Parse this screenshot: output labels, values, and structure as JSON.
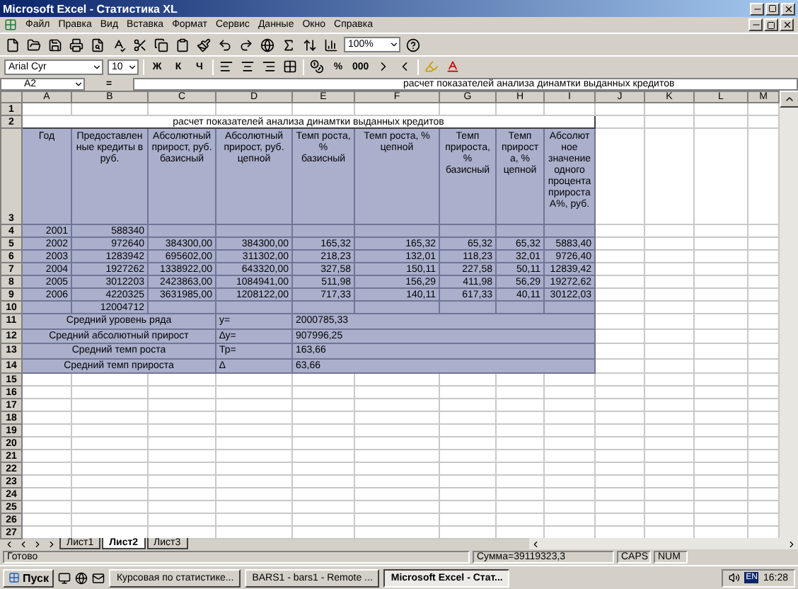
{
  "window": {
    "title": "Microsoft Excel - Статистика XL"
  },
  "menu": [
    "Файл",
    "Правка",
    "Вид",
    "Вставка",
    "Формат",
    "Сервис",
    "Данные",
    "Окно",
    "Справка"
  ],
  "toolbar": {
    "zoom": "100%",
    "font": "Arial Cyr",
    "font_size": "10",
    "format_buttons": [
      "Ж",
      "К",
      "Ч"
    ],
    "number_buttons": [
      "%",
      "000"
    ]
  },
  "formula_bar": {
    "cell": "A2",
    "equals": "=",
    "content": "расчет показателей анализа динамтки выданных кредитов"
  },
  "sheet": {
    "columns": [
      "A",
      "B",
      "C",
      "D",
      "E",
      "F",
      "G",
      "H",
      "I",
      "J",
      "K",
      "L",
      "M"
    ],
    "row_numbers": [
      "1",
      "2",
      "3",
      "4",
      "5",
      "6",
      "7",
      "8",
      "9",
      "10",
      "11",
      "12",
      "13",
      "14",
      "15",
      "16",
      "17",
      "18",
      "19",
      "20",
      "21",
      "22",
      "23",
      "24",
      "25",
      "26",
      "27"
    ],
    "title": "расчет показателей анализа динамтки выданных кредитов",
    "header": [
      "Год",
      "Предоставленные кредиты в руб.",
      "Абсолютный прирост, руб. базисный",
      "Абсолютный прирост, руб. цепной",
      "Темп роста, % базисный",
      "Темп роста, % цепной",
      "Темп прироста, % базисный",
      "Темп прироста, % цепной",
      "Абсолютное значение одного процента прироста А%, руб."
    ],
    "rows": [
      {
        "year": "2001",
        "credit": "588340"
      },
      {
        "year": "2002",
        "credit": "972640",
        "abs_base": "384300,00",
        "abs_chain": "384300,00",
        "growth_base": "165,32",
        "growth_chain": "165,32",
        "inc_base": "65,32",
        "inc_chain": "65,32",
        "one_percent": "5883,40"
      },
      {
        "year": "2003",
        "credit": "1283942",
        "abs_base": "695602,00",
        "abs_chain": "311302,00",
        "growth_base": "218,23",
        "growth_chain": "132,01",
        "inc_base": "118,23",
        "inc_chain": "32,01",
        "one_percent": "9726,40"
      },
      {
        "year": "2004",
        "credit": "1927262",
        "abs_base": "1338922,00",
        "abs_chain": "643320,00",
        "growth_base": "327,58",
        "growth_chain": "150,11",
        "inc_base": "227,58",
        "inc_chain": "50,11",
        "one_percent": "12839,42"
      },
      {
        "year": "2005",
        "credit": "3012203",
        "abs_base": "2423863,00",
        "abs_chain": "1084941,00",
        "growth_base": "511,98",
        "growth_chain": "156,29",
        "inc_base": "411,98",
        "inc_chain": "56,29",
        "one_percent": "19272,62"
      },
      {
        "year": "2006",
        "credit": "4220325",
        "abs_base": "3631985,00",
        "abs_chain": "1208122,00",
        "growth_base": "717,33",
        "growth_chain": "140,11",
        "inc_base": "617,33",
        "inc_chain": "40,11",
        "one_percent": "30122,03"
      }
    ],
    "total": "12004712",
    "summary": [
      {
        "label": "Средний уровень ряда",
        "symbol": "y=",
        "value": "2000785,33"
      },
      {
        "label": "Средний абсолютный прирост",
        "symbol": "∆y=",
        "value": "907996,25"
      },
      {
        "label": "Средний темп роста",
        "symbol": "Тр=",
        "value": "163,66"
      },
      {
        "label": "Средний темп прироста",
        "symbol": "∆",
        "value": "63,66"
      }
    ]
  },
  "sheet_tabs": [
    {
      "label": "Лист1",
      "selected": false
    },
    {
      "label": "Лист2",
      "selected": true
    },
    {
      "label": "Лист3",
      "selected": false
    }
  ],
  "status_bar": {
    "state": "Готово",
    "sum": "Сумма=39119323,3",
    "indicators": [
      "CAPS",
      "NUM"
    ]
  },
  "taskbar": {
    "start": "Пуск",
    "tasks": [
      {
        "label": "Курсовая по статистике...",
        "selected": false
      },
      {
        "label": "BARS1 - bars1 - Remote ...",
        "selected": false
      },
      {
        "label": "Microsoft Excel - Стат...",
        "selected": true
      }
    ],
    "language": "EN",
    "clock": "16:28"
  }
}
